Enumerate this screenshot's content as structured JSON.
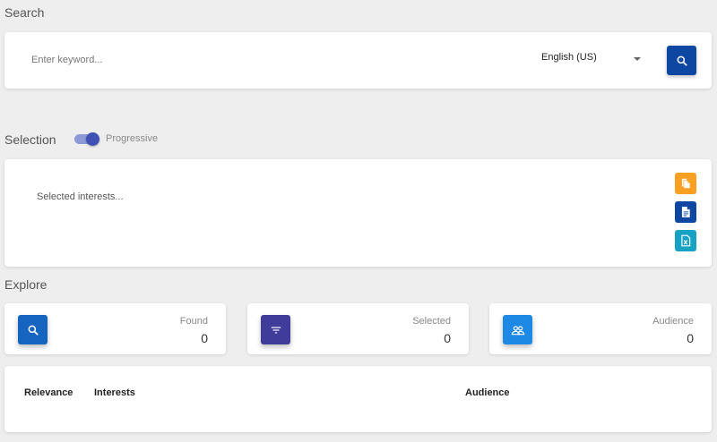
{
  "search": {
    "title": "Search",
    "keyword_placeholder": "Enter keyword...",
    "keyword_value": "",
    "language": "English (US)",
    "button_icon": "search-icon",
    "button_color": "#0d47a1"
  },
  "selection": {
    "title": "Selection",
    "toggle_label": "Progressive",
    "toggle_on": true,
    "placeholder": "Selected interests...",
    "actions": [
      {
        "icon": "copy-icon",
        "color": "#f7a021"
      },
      {
        "icon": "document-icon",
        "color": "#0d47a1"
      },
      {
        "icon": "excel-file-icon",
        "color": "#17a2c4"
      }
    ]
  },
  "explore": {
    "title": "Explore",
    "stats": {
      "found": {
        "label": "Found",
        "value": "0",
        "icon": "search-icon",
        "color": "#1565c0"
      },
      "selected": {
        "label": "Selected",
        "value": "0",
        "icon": "filter-icon",
        "color": "#3f3d99"
      },
      "audience": {
        "label": "Audience",
        "value": "0",
        "icon": "people-icon",
        "color": "#1e88e5"
      }
    },
    "table": {
      "columns": [
        "Relevance",
        "Interests",
        "Audience"
      ],
      "rows": []
    }
  }
}
